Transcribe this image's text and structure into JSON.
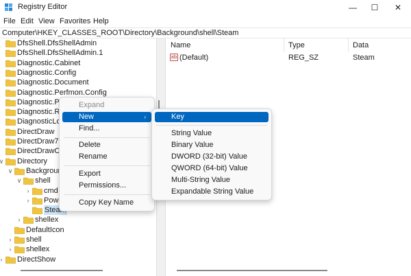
{
  "window": {
    "title": "Registry Editor",
    "minimize_glyph": "—",
    "maximize_glyph": "☐",
    "close_glyph": "✕"
  },
  "menu": [
    "File",
    "Edit",
    "View",
    "Favorites",
    "Help"
  ],
  "address": "Computer\\HKEY_CLASSES_ROOT\\Directory\\Background\\shell\\Steam",
  "tree": [
    {
      "label": "DfsShell.DfsShellAdmin",
      "indent": 0,
      "chevron": ""
    },
    {
      "label": "DfsShell.DfsShellAdmin.1",
      "indent": 0,
      "chevron": ""
    },
    {
      "label": "Diagnostic.Cabinet",
      "indent": 0,
      "chevron": ""
    },
    {
      "label": "Diagnostic.Config",
      "indent": 0,
      "chevron": ""
    },
    {
      "label": "Diagnostic.Document",
      "indent": 0,
      "chevron": ""
    },
    {
      "label": "Diagnostic.Perfmon.Config",
      "indent": 0,
      "chevron": ""
    },
    {
      "label": "Diagnostic.Per",
      "indent": 0,
      "chevron": ""
    },
    {
      "label": "Diagnostic.Res",
      "indent": 0,
      "chevron": ""
    },
    {
      "label": "DiagnosticLog",
      "indent": 0,
      "chevron": ""
    },
    {
      "label": "DirectDraw",
      "indent": 0,
      "chevron": ""
    },
    {
      "label": "DirectDraw7",
      "indent": 0,
      "chevron": ""
    },
    {
      "label": "DirectDrawClip",
      "indent": 0,
      "chevron": ""
    },
    {
      "label": "Directory",
      "indent": 0,
      "chevron": "∨"
    },
    {
      "label": "Backgroun",
      "indent": 1,
      "chevron": "∨"
    },
    {
      "label": "shell",
      "indent": 2,
      "chevron": "∨"
    },
    {
      "label": "cmd",
      "indent": 3,
      "chevron": "›"
    },
    {
      "label": "Powe",
      "indent": 3,
      "chevron": "›"
    },
    {
      "label": "Steam",
      "indent": 3,
      "chevron": "",
      "selected": true
    },
    {
      "label": "shellex",
      "indent": 2,
      "chevron": "›"
    },
    {
      "label": "DefaultIcon",
      "indent": 1,
      "chevron": ""
    },
    {
      "label": "shell",
      "indent": 1,
      "chevron": "›"
    },
    {
      "label": "shellex",
      "indent": 1,
      "chevron": "›"
    },
    {
      "label": "DirectShow",
      "indent": 0,
      "chevron": "›"
    }
  ],
  "columns": [
    "Name",
    "Type",
    "Data"
  ],
  "values": [
    {
      "name": "(Default)",
      "type": "REG_SZ",
      "data": "Steam",
      "icon_text": "ab"
    }
  ],
  "context_menu": {
    "items": [
      "Expand",
      "New",
      "Find...",
      "Delete",
      "Rename",
      "Export",
      "Permissions...",
      "Copy Key Name"
    ],
    "submenu_arrow": "›"
  },
  "new_submenu": {
    "items": [
      "Key",
      "String Value",
      "Binary Value",
      "DWORD (32-bit) Value",
      "QWORD (64-bit) Value",
      "Multi-String Value",
      "Expandable String Value"
    ]
  },
  "colors": {
    "highlight": "#0067c0",
    "folder": "#f0c43d",
    "selection": "#cce4f7"
  }
}
